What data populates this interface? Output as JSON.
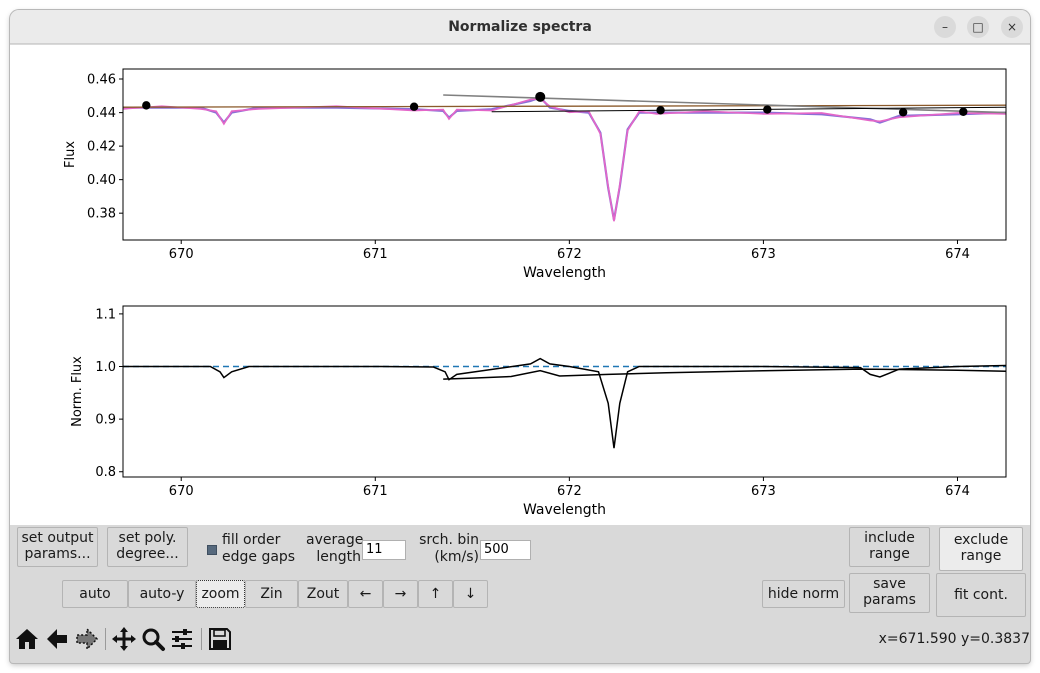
{
  "window": {
    "title": "Normalize spectra"
  },
  "window_controls": {
    "minimize": "–",
    "maximize": "□",
    "close": "×"
  },
  "chart_data": [
    {
      "type": "line",
      "title": "",
      "xlabel": "Wavelength",
      "ylabel": "Flux",
      "xlim": [
        669.7,
        674.25
      ],
      "ylim": [
        0.364,
        0.466
      ],
      "xticks": [
        "670",
        "671",
        "672",
        "673",
        "674"
      ],
      "yticks": [
        "0.38",
        "0.40",
        "0.42",
        "0.44",
        "0.46"
      ],
      "colors": {
        "spectrum_a": "#8b6fd6",
        "spectrum_b": "#e466c8",
        "continuum": "#8b5a2b",
        "fit": "#000000",
        "fit_alt": "#808080",
        "points": "#000000"
      },
      "series": [
        {
          "x": [
            669.7,
            669.9,
            670.1,
            670.18,
            670.22,
            670.26,
            670.4,
            670.8,
            671.2,
            671.35,
            671.38,
            671.42,
            671.6,
            671.8,
            671.85,
            671.9,
            672.0,
            672.1,
            672.16,
            672.2,
            672.23,
            672.26,
            672.3,
            672.36,
            672.45,
            672.7,
            673.0,
            673.3,
            673.55,
            673.6,
            673.7,
            674.0,
            674.25
          ],
          "y": [
            0.443,
            0.443,
            0.443,
            0.44,
            0.434,
            0.44,
            0.443,
            0.443,
            0.442,
            0.441,
            0.437,
            0.441,
            0.442,
            0.447,
            0.449,
            0.443,
            0.441,
            0.44,
            0.428,
            0.395,
            0.376,
            0.396,
            0.43,
            0.44,
            0.44,
            0.44,
            0.44,
            0.439,
            0.436,
            0.434,
            0.438,
            0.439,
            0.44
          ]
        }
      ],
      "continuum_points": {
        "x": [
          669.82,
          671.2,
          671.85,
          672.47,
          673.02,
          673.72,
          674.03
        ],
        "y": [
          0.4443,
          0.4435,
          0.4494,
          0.4414,
          0.4418,
          0.4402,
          0.4405
        ]
      },
      "fit_lines": [
        {
          "name": "",
          "x": [
            669.7,
            674.25
          ],
          "y": [
            0.4432,
            0.4444
          ]
        },
        {
          "name": "",
          "x": [
            671.35,
            674.25
          ],
          "y": [
            0.4505,
            0.44
          ]
        },
        {
          "name": "",
          "x": [
            671.6,
            674.25
          ],
          "y": [
            0.4405,
            0.4432
          ]
        }
      ]
    },
    {
      "type": "line",
      "title": "",
      "xlabel": "Wavelength",
      "ylabel": "Norm. Flux",
      "xlim": [
        669.7,
        674.25
      ],
      "ylim": [
        0.79,
        1.115
      ],
      "xticks": [
        "670",
        "671",
        "672",
        "673",
        "674"
      ],
      "yticks": [
        "0.8",
        "0.9",
        "1.0",
        "1.1"
      ],
      "reference_line": {
        "y": 1.0,
        "color": "#1f77b4",
        "style": "dashed"
      },
      "series": [
        {
          "x": [
            669.7,
            670.0,
            670.15,
            670.2,
            670.22,
            670.26,
            670.35,
            671.0,
            671.3,
            671.36,
            671.38,
            671.42,
            671.8,
            671.85,
            671.9,
            672.0,
            672.15,
            672.2,
            672.23,
            672.26,
            672.3,
            672.36,
            672.5,
            673.0,
            673.5,
            673.55,
            673.6,
            673.7,
            674.0,
            674.25
          ],
          "y": [
            1.0,
            1.0,
            1.0,
            0.99,
            0.979,
            0.99,
            1.0,
            1.0,
            0.999,
            0.99,
            0.975,
            0.985,
            1.005,
            1.015,
            1.005,
            1.0,
            0.99,
            0.93,
            0.845,
            0.93,
            0.99,
            1.0,
            1.0,
            1.0,
            0.998,
            0.985,
            0.98,
            0.995,
            1.0,
            1.002
          ]
        },
        {
          "x": [
            671.35,
            671.5,
            671.7,
            671.85,
            671.95,
            672.2,
            672.5,
            673.0,
            673.5,
            674.0,
            674.25
          ],
          "y": [
            0.976,
            0.978,
            0.981,
            0.992,
            0.982,
            0.985,
            0.988,
            0.992,
            0.995,
            0.993,
            0.991
          ]
        }
      ]
    }
  ],
  "controls": {
    "set_output_params": [
      "set output",
      "params..."
    ],
    "set_poly_degree": [
      "set poly.",
      "degree..."
    ],
    "fill_gaps": [
      "fill order",
      "edge gaps"
    ],
    "average_length_label": [
      "average",
      "length"
    ],
    "average_length_value": "11",
    "search_bin_label": [
      "srch. bin",
      "(km/s)"
    ],
    "search_bin_value": "500",
    "include_range": [
      "include",
      "range"
    ],
    "exclude_range": [
      "exclude",
      "range"
    ],
    "save_params": [
      "save",
      "params"
    ],
    "fit_cont": "fit cont.",
    "hide_norm": "hide norm",
    "nav": [
      "auto",
      "auto-y",
      "zoom",
      "Zin",
      "Zout",
      "←",
      "→",
      "↑",
      "↓"
    ]
  },
  "toolbar": {
    "icons": [
      "home-icon",
      "back-icon",
      "forward-icon",
      "pan-icon",
      "zoom-icon",
      "configure-subplots-icon",
      "save-icon"
    ],
    "coords": "x=671.590 y=0.3837"
  }
}
